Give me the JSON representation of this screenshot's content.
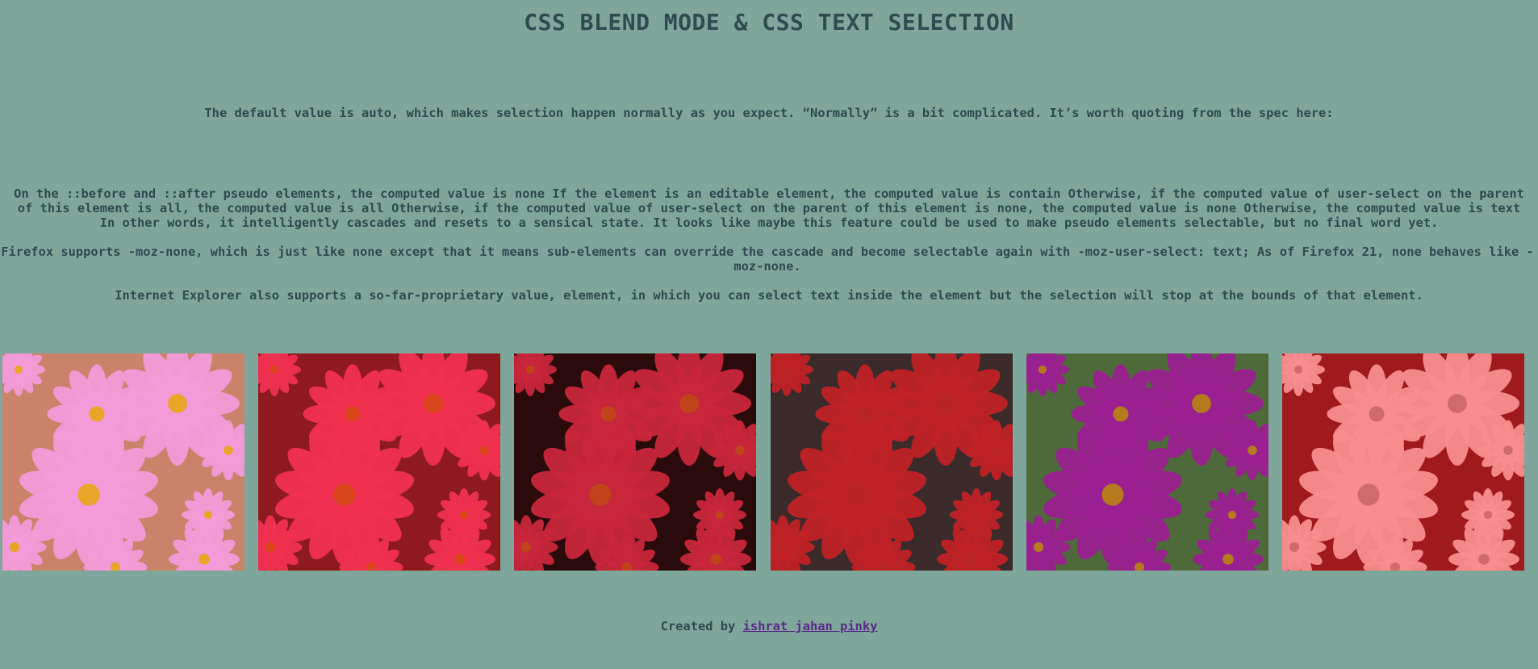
{
  "title": "CSS BLEND MODE & CSS TEXT SELECTION",
  "paragraphs": {
    "intro": "The default value is auto, which makes selection happen normally as you expect. “Normally” is a bit complicated. It’s worth quoting from the spec here:",
    "spec": "On the ::before and ::after pseudo elements, the computed value is none If the element is an editable element, the computed value is contain Otherwise, if the computed value of user-select on the parent of this element is all, the computed value is all Otherwise, if the computed value of user-select on the parent of this element is none, the computed value is none Otherwise, the computed value is text In other words, it intelligently cascades and resets to a sensical state. It looks like maybe this feature could be used to make pseudo elements selectable, but no final word yet.",
    "firefox": "Firefox supports -moz-none, which is just like none except that it means sub-elements can override the cascade and become selectable again with -moz-user-select: text; As of Firefox 21, none behaves like -moz-none.",
    "ie": "Internet Explorer also supports a so-far-proprietary value, element, in which you can select text inside the element but the selection will stop at the bounds of that element."
  },
  "gallery": {
    "images": [
      {
        "label": "flower-photo-normal",
        "bg": "#c9836a",
        "petal": "#f29ad8",
        "center": "#e8a52a"
      },
      {
        "label": "flower-photo-multiply",
        "bg": "#8f1a1e",
        "petal": "#f0304f",
        "center": "#d9451c"
      },
      {
        "label": "flower-photo-darken",
        "bg": "#2a0a0a",
        "petal": "#c8263a",
        "center": "#c1431c"
      },
      {
        "label": "flower-photo-color",
        "bg": "#3a2a2a",
        "petal": "#bf2227",
        "center": "#b82325"
      },
      {
        "label": "flower-photo-exclusion",
        "bg": "#4f6a3a",
        "petal": "#9a2090",
        "center": "#b5791e"
      },
      {
        "label": "flower-photo-screen",
        "bg": "#9f1a1c",
        "petal": "#f98d8d",
        "center": "#d16b6b"
      }
    ]
  },
  "footer": {
    "prefix": "Created by ",
    "author_link": "ishrat jahan pinky"
  }
}
